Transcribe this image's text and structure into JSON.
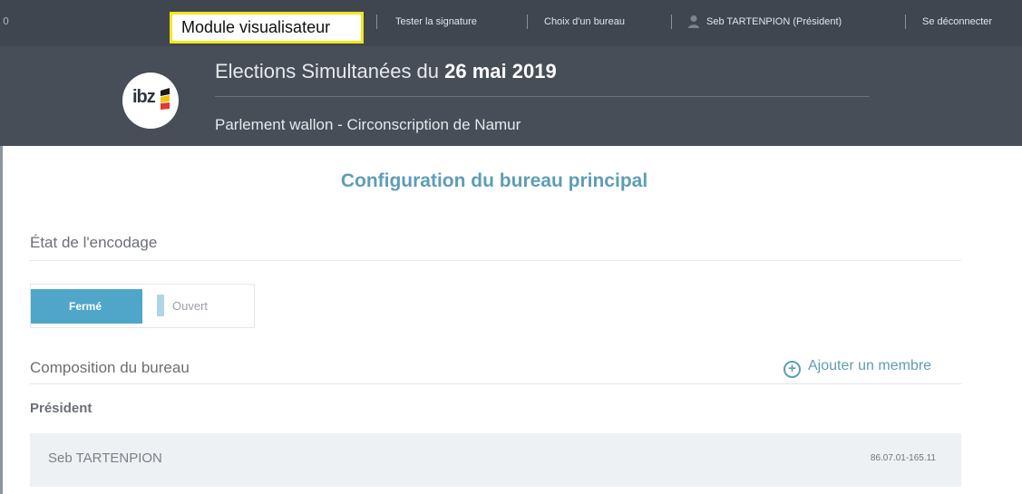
{
  "topbar": {
    "corner_mark": "0",
    "module_label": "Module visualisateur",
    "links": {
      "test_signature": "Tester la signature",
      "choose_office": "Choix d'un bureau",
      "user": "Seb TARTENPION (Président)",
      "logout": "Se déconnecter"
    }
  },
  "header": {
    "logo_text": "ibz",
    "title_prefix": "Elections Simultanées du",
    "title_date": "26 mai 2019",
    "subtitle": "Parlement wallon - Circonscription de Namur"
  },
  "main": {
    "page_title": "Configuration du bureau principal",
    "encoding": {
      "section_title": "État de l'encodage",
      "toggle_on_label": "Fermé",
      "toggle_off_label": "Ouvert",
      "selected": "Fermé"
    },
    "composition": {
      "section_title": "Composition du bureau",
      "add_member_label": "Ajouter un membre",
      "role_label": "Président",
      "member_name": "Seb TARTENPION",
      "member_id": "86.07.01-165.11"
    }
  },
  "colors": {
    "topbar_bg": "#3f4650",
    "header_bg": "#474e58",
    "accent": "#5e9db7",
    "toggle_active": "#4fa6c9",
    "highlight_border": "#f3e61c"
  }
}
